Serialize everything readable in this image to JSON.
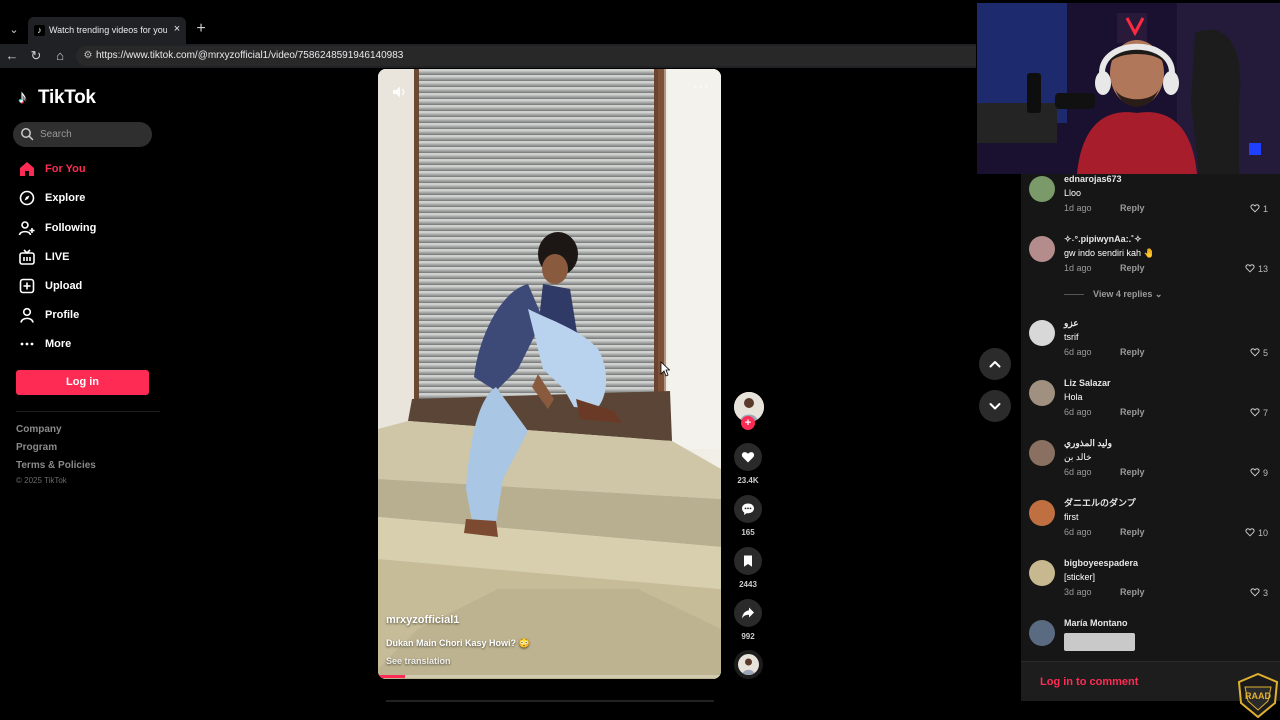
{
  "browser": {
    "tab_title": "Watch trending videos for you | TikTok",
    "tab_close": "×",
    "new_tab": "+",
    "url": "https://www.tiktok.com/@mrxyzofficial1/video/7586248591946140983"
  },
  "sidebar": {
    "logo_text": "TikTok",
    "search_placeholder": "Search",
    "nav": [
      {
        "label": "For You",
        "icon": "home-icon",
        "active": true
      },
      {
        "label": "Explore",
        "icon": "compass-icon"
      },
      {
        "label": "Following",
        "icon": "user-plus-icon"
      },
      {
        "label": "LIVE",
        "icon": "live-tv-icon"
      },
      {
        "label": "Upload",
        "icon": "plus-square-icon"
      },
      {
        "label": "Profile",
        "icon": "person-icon"
      },
      {
        "label": "More",
        "icon": "ellipsis-icon"
      }
    ],
    "login_label": "Log in",
    "footer_links": [
      "Company",
      "Program",
      "Terms & Policies"
    ],
    "copyright": "© 2025 TikTok"
  },
  "video": {
    "author": "mrxyzofficial1",
    "caption": "Dukan Main Chori Kasy Howi? 😳",
    "see_translation": "See translation",
    "progress": 0.08,
    "menu": "···"
  },
  "actions": {
    "likes": "23.4K",
    "comments": "165",
    "saves": "2443",
    "shares": "992",
    "follow": "+"
  },
  "comments": [
    {
      "user": "ednarojas673",
      "text": "Lloo",
      "age": "1d ago",
      "reply": "Reply",
      "likes": "1",
      "avatar_color": "#7a9a6a"
    },
    {
      "user": "✧˖°.pipiwynAa:.˚✧",
      "text": "gw indo sendiri kah 🤚",
      "age": "1d ago",
      "reply": "Reply",
      "likes": "13",
      "avatar_color": "#b58c8c"
    },
    {
      "user": "عزو",
      "text": "tsrif",
      "age": "6d ago",
      "reply": "Reply",
      "likes": "5",
      "avatar_color": "#d8d8d8"
    },
    {
      "user": "Liz Salazar",
      "text": "Hola",
      "age": "6d ago",
      "reply": "Reply",
      "likes": "7",
      "avatar_color": "#a09080"
    },
    {
      "user": "وليد المذوري",
      "text": "خالد بن",
      "age": "6d ago",
      "reply": "Reply",
      "likes": "9",
      "avatar_color": "#8a7060"
    },
    {
      "user": "ダニエルのダンプ",
      "text": "first",
      "age": "6d ago",
      "reply": "Reply",
      "likes": "10",
      "avatar_color": "#c07040"
    },
    {
      "user": "bigboyeespadera",
      "text": "[sticker]",
      "age": "3d ago",
      "reply": "Reply",
      "likes": "3",
      "avatar_color": "#c8b890"
    },
    {
      "user": "María Montano",
      "text": "",
      "age": "",
      "reply": "",
      "likes": "",
      "avatar_color": "#5a6a80"
    }
  ],
  "view_replies": "View 4 replies",
  "login_to_comment": "Log in to comment",
  "badge_text": "RAAD",
  "colors": {
    "accent": "#fe2c55",
    "panel": "#161616",
    "background": "#000000"
  }
}
